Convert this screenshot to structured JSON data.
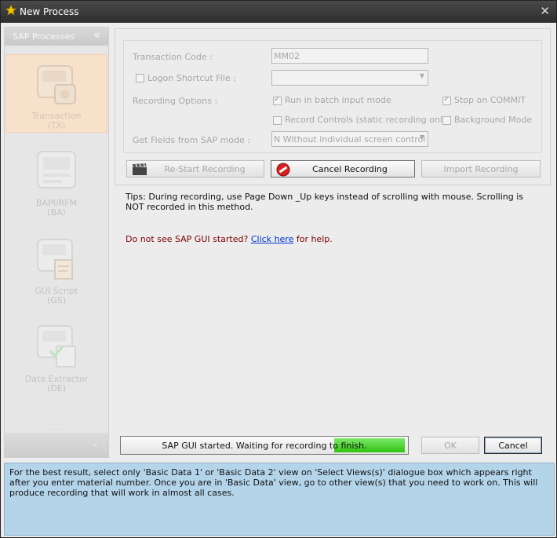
{
  "window": {
    "title": "New Process",
    "close_glyph": "✕"
  },
  "sidebar": {
    "header": "SAP Processes",
    "collapse_glyph": "«",
    "items": [
      {
        "label": "Transaction",
        "code": "(TX)",
        "icon": "transaction-icon",
        "active": true
      },
      {
        "label": "BAPI/RFM",
        "code": "(BA)",
        "icon": "bapi-icon",
        "active": false
      },
      {
        "label": "GUI Script",
        "code": "(GS)",
        "icon": "gui-script-icon",
        "active": false
      },
      {
        "label": "Data Extractor",
        "code": "(DE)",
        "icon": "data-extractor-icon",
        "active": false
      }
    ],
    "grip": "....",
    "footer_chevron": "⌄"
  },
  "form": {
    "transaction_code_label": "Transaction Code :",
    "transaction_code_value": "MM02",
    "logon_shortcut_label": "Logon Shortcut File :",
    "logon_shortcut_checked": false,
    "logon_shortcut_value": "",
    "recording_options_label": "Recording Options  :",
    "options": {
      "batch_input": {
        "label": "Run in batch input mode",
        "checked": true
      },
      "stop_on_commit": {
        "label": "Stop on COMMIT",
        "checked": true
      },
      "record_controls": {
        "label": "Record Controls (static recording only)",
        "checked": false
      },
      "background_mode": {
        "label": "Background Mode",
        "checked": false
      }
    },
    "get_fields_label": "Get Fields from SAP mode :",
    "get_fields_value": "N Without individual screen control"
  },
  "buttons": {
    "restart": "Re-Start Recording",
    "cancel_recording": "Cancel Recording",
    "import": "Import Recording",
    "ok": "OK",
    "cancel": "Cancel"
  },
  "tips": "Tips: During recording, use Page Down _Up keys instead of scrolling with mouse. Scrolling is NOT recorded in this method.",
  "help": {
    "prefix": "Do not see SAP GUI started?",
    "link": "Click here",
    "suffix": "for help."
  },
  "status": {
    "text": "SAP GUI started. Waiting for recording to finish.",
    "progress": 0.25
  },
  "info": "For the best result, select only 'Basic Data 1' or 'Basic Data 2' view on 'Select Views(s)' dialogue box which appears right after you enter material number. Once you are in 'Basic Data' view, go to other view(s) that you need to work on. This will produce recording that will work in almost all cases.",
  "colors": {
    "accent_info": "#b3d4e9",
    "active_item": "#f7e1cb",
    "progress": "#2fc30f"
  }
}
